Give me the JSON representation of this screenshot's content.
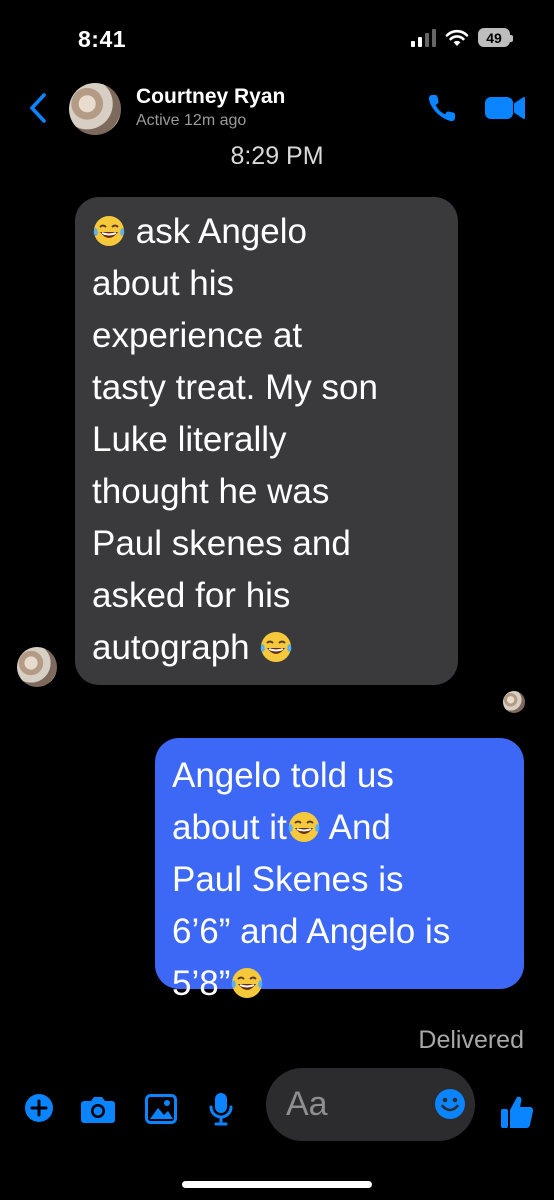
{
  "status_bar": {
    "time": "8:41",
    "battery": "49"
  },
  "header": {
    "contact_name": "Courtney Ryan",
    "contact_status": "Active 12m ago"
  },
  "thread": {
    "timestamp": "8:29 PM",
    "incoming": {
      "lines": [
        "ask Angelo",
        "about his",
        "experience at",
        "tasty treat. My son",
        "Luke literally",
        "thought he was",
        "Paul skenes and",
        "asked for his",
        "autograph"
      ]
    },
    "outgoing": {
      "lines": [
        "Angelo told us",
        "about it",
        "And",
        "Paul Skenes is",
        "6’6” and Angelo is",
        "5’8”"
      ]
    },
    "delivery_status": "Delivered"
  },
  "composer": {
    "placeholder": "Aa"
  },
  "colors": {
    "accent": "#0a84ff",
    "outgoing_bubble": "#3d68f5",
    "incoming_bubble": "#3a3a3c"
  }
}
